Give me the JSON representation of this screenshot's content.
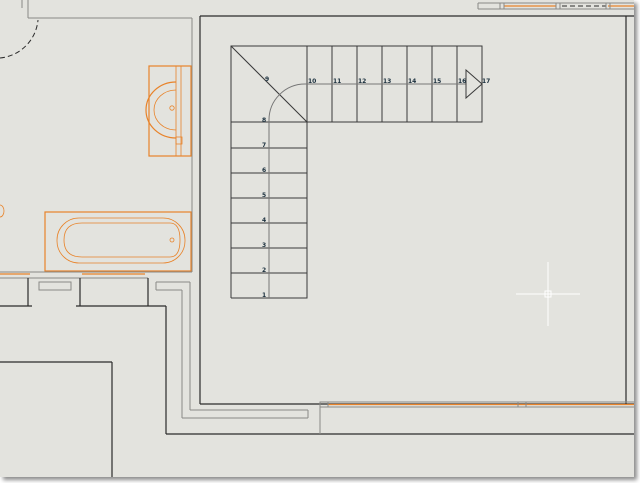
{
  "drawing": {
    "stair_numbers": [
      "1",
      "2",
      "3",
      "4",
      "5",
      "6",
      "7",
      "8",
      "9",
      "10",
      "11",
      "12",
      "13",
      "14",
      "15",
      "16",
      "17"
    ]
  },
  "colors": {
    "background": "#e3e3de",
    "wall": "#2b2b2b",
    "fixture": "#e8832a",
    "stair_text": "#1a2f3d",
    "cursor": "#ffffff"
  }
}
